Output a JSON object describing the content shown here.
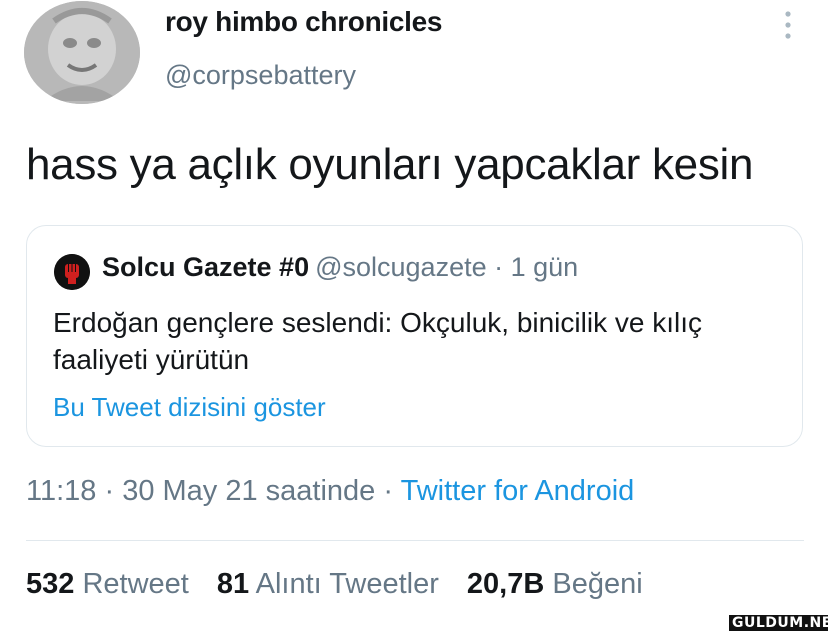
{
  "author": {
    "display_name": "roy himbo chronicles",
    "handle": "@corpsebattery"
  },
  "tweet": {
    "text": "hass ya açlık oyunları yapcaklar kesin"
  },
  "quote": {
    "name": "Solcu Gazete #0",
    "meta": "@solcugazete · 1 gün",
    "text": "Erdoğan gençlere seslendi: Okçuluk, binicilik ve kılıç faaliyeti yürütün",
    "link": "Bu Tweet dizisini göster"
  },
  "timestamp": {
    "time": "11:18 · 30 May 21 saatinde ·",
    "source": "Twitter for Android"
  },
  "stats": {
    "retweets_count": "532",
    "retweets_label": "Retweet",
    "quotes_count": "81",
    "quotes_label": "Alıntı Tweetler",
    "likes_count": "20,7B",
    "likes_label": "Beğeni"
  },
  "watermark": "GULDUM.NET",
  "colors": {
    "text": "#14171a",
    "secondary": "#657786",
    "link": "#1b95e0",
    "border": "#e1e8ed"
  },
  "icons": {
    "more": "more-vertical-icon"
  }
}
